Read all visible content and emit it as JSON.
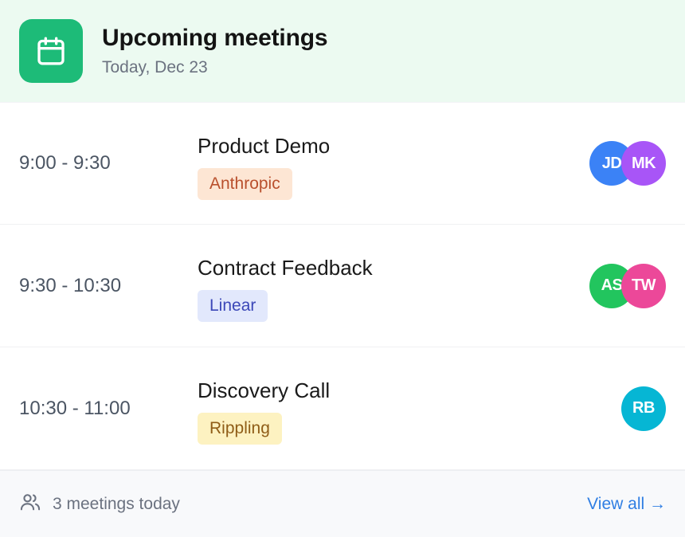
{
  "header": {
    "icon": "calendar-icon",
    "title": "Upcoming meetings",
    "subtitle": "Today, Dec 23",
    "accent": "#1dbb78"
  },
  "meetings": [
    {
      "time": "9:00 - 9:30",
      "title": "Product Demo",
      "company": "Anthropic",
      "tag_color": "orange",
      "attendees": [
        {
          "initials": "JD",
          "color": "#3b82f6"
        },
        {
          "initials": "MK",
          "color": "#a855f7"
        }
      ]
    },
    {
      "time": "9:30 - 10:30",
      "title": "Contract Feedback",
      "company": "Linear",
      "tag_color": "blue",
      "attendees": [
        {
          "initials": "AS",
          "color": "#22c55e"
        },
        {
          "initials": "TW",
          "color": "#ec4899"
        }
      ]
    },
    {
      "time": "10:30 - 11:00",
      "title": "Discovery Call",
      "company": "Rippling",
      "tag_color": "yellow",
      "attendees": [
        {
          "initials": "RB",
          "color": "#06b6d4"
        }
      ]
    }
  ],
  "footer": {
    "icon": "users-icon",
    "count_text": "3 meetings today",
    "view_all_label": "View all →"
  }
}
